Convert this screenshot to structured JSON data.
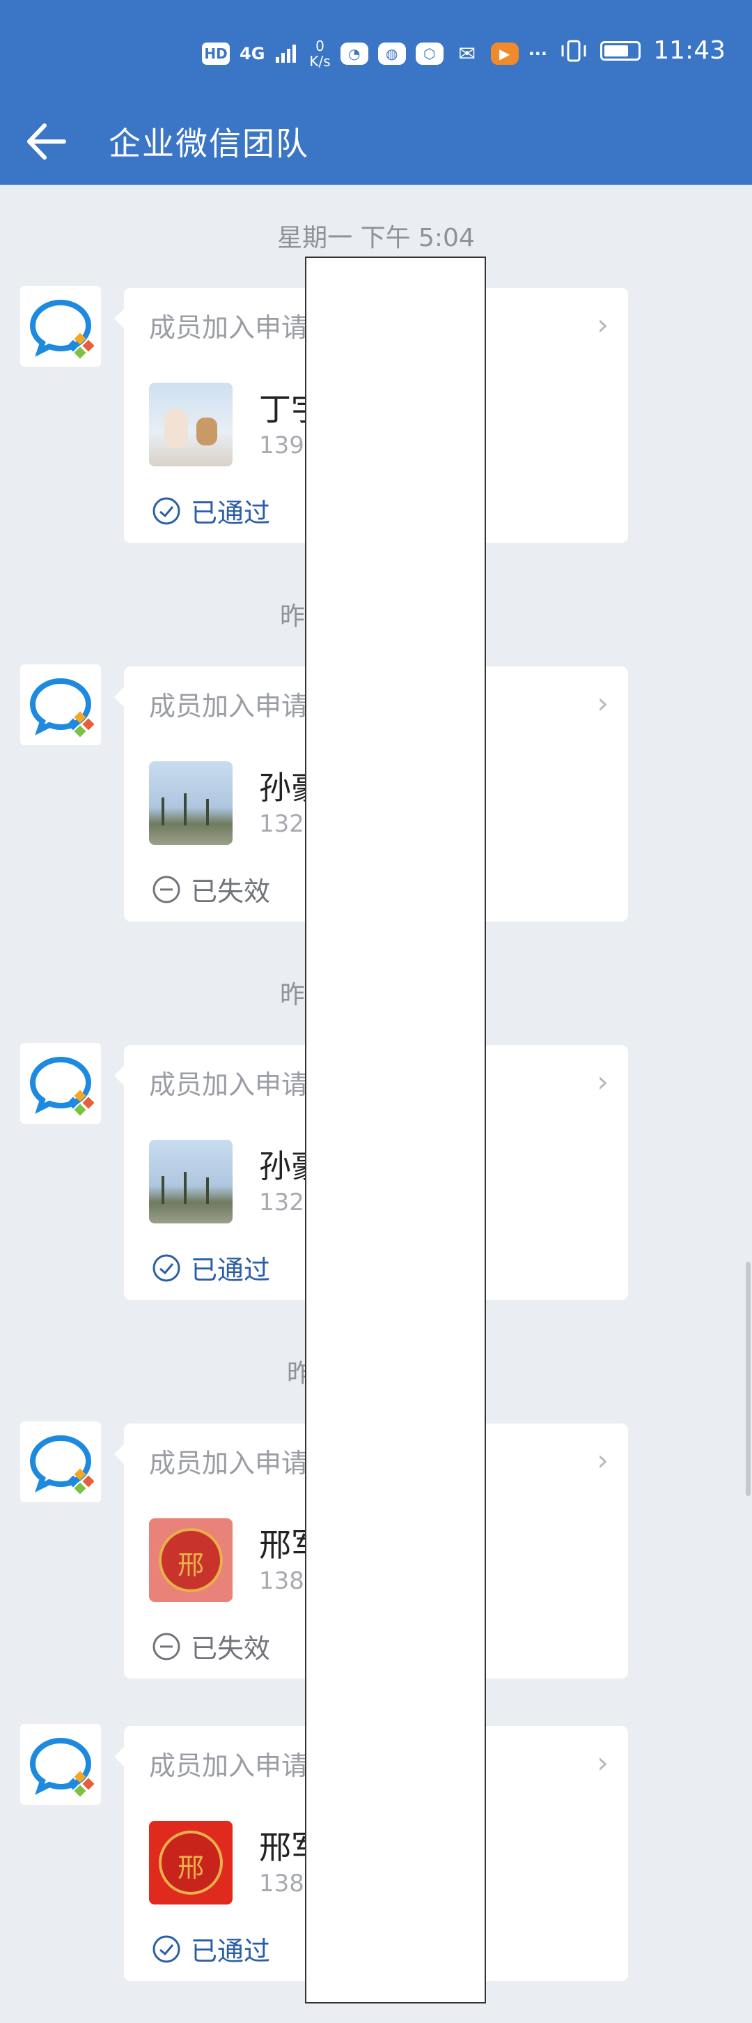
{
  "status_bar": {
    "hd": "HD",
    "signal": "4G",
    "speed_value": "0",
    "speed_unit": "K/s",
    "more": "···",
    "time": "11:43"
  },
  "header": {
    "title": "企业微信团队"
  },
  "colors": {
    "header_bg": "#3a75c6",
    "page_bg": "#eaedf2",
    "status_ok": "#2a5ea8",
    "status_fail": "#70737a"
  },
  "messages": [
    {
      "timestamp": "星期一 下午 5:04",
      "card_title": "成员加入申请",
      "user_name": "丁宇",
      "phone": "139",
      "photo": "baby-teddy-photo",
      "status": "已通过",
      "status_type": "approved"
    },
    {
      "timestamp": "昨",
      "card_title": "成员加入申请",
      "user_name": "孙豪",
      "phone": "132",
      "photo": "palm-trees-photo",
      "status": "已失效",
      "status_type": "expired"
    },
    {
      "timestamp": "昨",
      "card_title": "成员加入申请",
      "user_name": "孙豪",
      "phone": "132",
      "photo": "palm-trees-photo",
      "status": "已通过",
      "status_type": "approved"
    },
    {
      "timestamp": "昨",
      "card_title": "成员加入申请",
      "user_name": "邢军",
      "phone": "138",
      "photo": "red-seal-photo",
      "status": "已失效",
      "status_type": "expired"
    },
    {
      "timestamp": "",
      "card_title": "成员加入申请",
      "user_name": "邢军",
      "phone": "138",
      "photo": "red-seal-photo",
      "status": "已通过",
      "status_type": "approved"
    }
  ]
}
